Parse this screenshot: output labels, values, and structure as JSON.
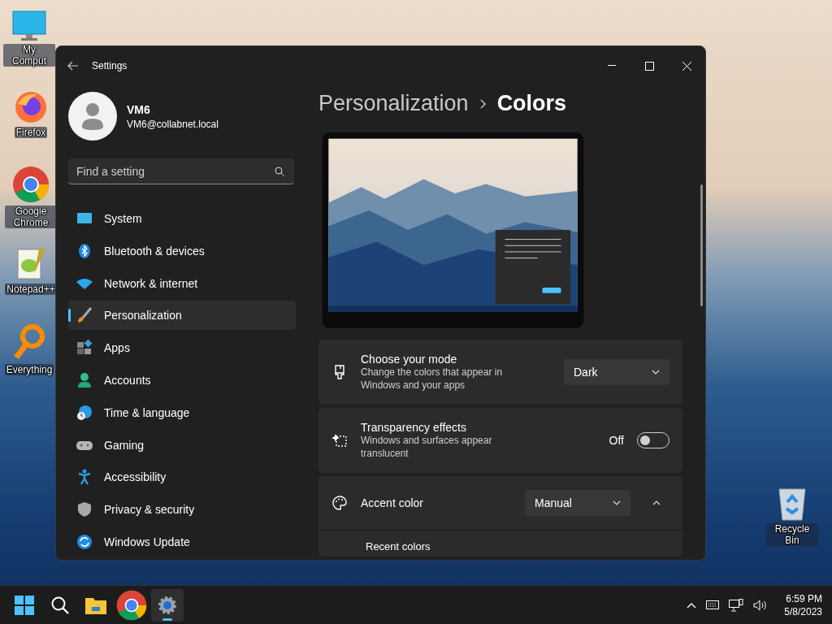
{
  "desktop_icons": [
    {
      "label": "My Comput",
      "kind": "computer"
    },
    {
      "label": "Firefox",
      "kind": "firefox"
    },
    {
      "label": "Google Chrome",
      "kind": "chrome"
    },
    {
      "label": "Notepad++",
      "kind": "notepad"
    },
    {
      "label": "Everything",
      "kind": "everything"
    },
    {
      "label": "Recycle Bin",
      "kind": "bin"
    }
  ],
  "window": {
    "title": "Settings"
  },
  "account": {
    "name": "VM6",
    "email": "VM6@collabnet.local"
  },
  "search": {
    "placeholder": "Find a setting"
  },
  "sidebar": {
    "items": [
      {
        "label": "System",
        "selected": false
      },
      {
        "label": "Bluetooth & devices",
        "selected": false
      },
      {
        "label": "Network & internet",
        "selected": false
      },
      {
        "label": "Personalization",
        "selected": true
      },
      {
        "label": "Apps",
        "selected": false
      },
      {
        "label": "Accounts",
        "selected": false
      },
      {
        "label": "Time & language",
        "selected": false
      },
      {
        "label": "Gaming",
        "selected": false
      },
      {
        "label": "Accessibility",
        "selected": false
      },
      {
        "label": "Privacy & security",
        "selected": false
      },
      {
        "label": "Windows Update",
        "selected": false
      }
    ]
  },
  "breadcrumb": [
    "Personalization",
    "Colors"
  ],
  "settings": [
    {
      "kind": "dropdown",
      "title": "Choose your mode",
      "description": "Change the colors that appear in Windows and your apps",
      "value": "Dark"
    },
    {
      "kind": "toggle",
      "title": "Transparency effects",
      "description": "Windows and surfaces appear translucent",
      "state_label": "Off",
      "on": false
    },
    {
      "kind": "expander",
      "title": "Accent color",
      "value": "Manual",
      "expanded": true,
      "sub_label": "Recent colors"
    }
  ],
  "taskbar": {
    "apps": [
      {
        "kind": "start",
        "selected": false
      },
      {
        "kind": "search",
        "selected": false
      },
      {
        "kind": "folder",
        "selected": false
      },
      {
        "kind": "chrome",
        "selected": false
      },
      {
        "kind": "settings",
        "selected": true
      }
    ],
    "time": "6:59 PM",
    "date": "5/8/2023"
  }
}
